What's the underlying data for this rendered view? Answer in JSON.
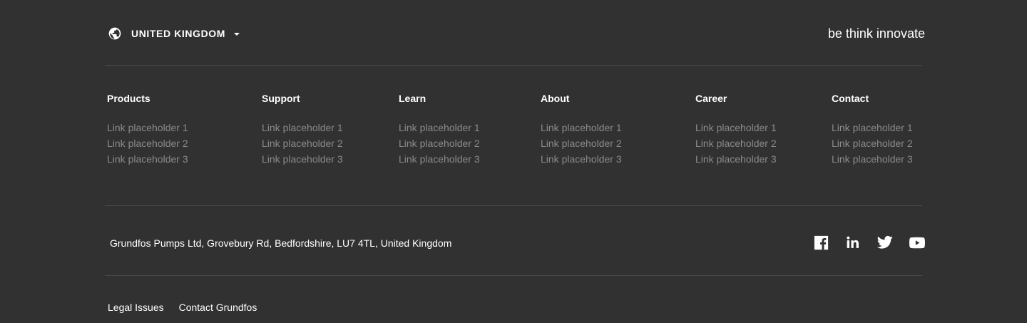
{
  "header": {
    "country": "UNITED KINGDOM",
    "tagline": "be think innovate"
  },
  "columns": [
    {
      "title": "Products",
      "links": [
        "Link placeholder 1",
        "Link placeholder 2",
        "Link placeholder 3"
      ]
    },
    {
      "title": "Support",
      "links": [
        "Link placeholder 1",
        "Link placeholder 2",
        "Link placeholder 3"
      ]
    },
    {
      "title": "Learn",
      "links": [
        "Link placeholder 1",
        "Link placeholder 2",
        "Link placeholder 3"
      ]
    },
    {
      "title": "About",
      "links": [
        "Link placeholder 1",
        "Link placeholder 2",
        "Link placeholder 3"
      ]
    },
    {
      "title": "Career",
      "links": [
        "Link placeholder 1",
        "Link placeholder 2",
        "Link placeholder 3"
      ]
    },
    {
      "title": "Contact",
      "links": [
        "Link placeholder 1",
        "Link placeholder 2",
        "Link placeholder 3"
      ]
    }
  ],
  "address": "Grundfos Pumps Ltd, Grovebury Rd, Bedfordshire, LU7 4TL, United Kingdom",
  "social": [
    "facebook-icon",
    "linkedin-icon",
    "twitter-icon",
    "youtube-icon"
  ],
  "bottom_links": {
    "legal": "Legal Issues",
    "contact": "Contact Grundfos"
  },
  "colors": {
    "background": "#313131",
    "text": "#ffffff",
    "muted_link": "#8a8a8a",
    "divider": "#4a4a4a"
  }
}
